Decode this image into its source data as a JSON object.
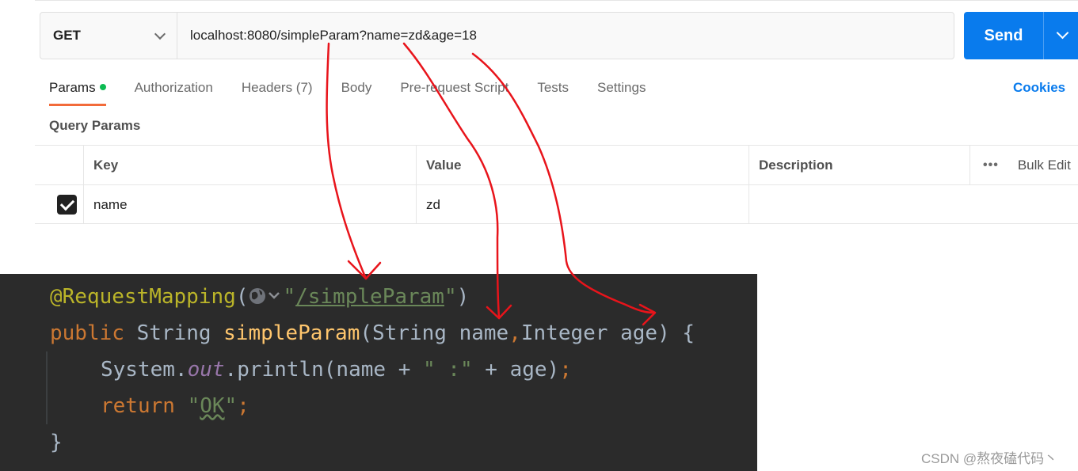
{
  "request": {
    "method": "GET",
    "url": "localhost:8080/simpleParam?name=zd&age=18",
    "send_label": "Send"
  },
  "tabs": [
    {
      "label": "Params",
      "active": true,
      "has_dot": true
    },
    {
      "label": "Authorization"
    },
    {
      "label": "Headers (7)"
    },
    {
      "label": "Body"
    },
    {
      "label": "Pre-request Script"
    },
    {
      "label": "Tests"
    },
    {
      "label": "Settings"
    }
  ],
  "cookies_label": "Cookies",
  "query_params": {
    "title": "Query Params",
    "headers": {
      "key": "Key",
      "value": "Value",
      "description": "Description",
      "more": "•••",
      "bulk_edit": "Bulk Edit"
    },
    "rows": [
      {
        "checked": true,
        "key": "name",
        "value": "zd",
        "description": ""
      }
    ]
  },
  "code": {
    "annotation": "@RequestMapping",
    "path": "/simpleParam",
    "kw_public": "public",
    "ret_type": "String",
    "method_name": "simpleParam",
    "param1_type": "String",
    "param1_name": "name",
    "param2_type": "Integer",
    "param2_name": "age",
    "sys": "System.",
    "out": "out",
    "println": ".println(name + ",
    "str_sep": "\" :\"",
    "println_tail": " + age)",
    "kw_return": "return",
    "ok": "OK",
    "close_brace": "}"
  },
  "watermark": "CSDN @熬夜磕代码丶",
  "colors": {
    "send": "#097bed",
    "active_tab_underline": "#f26b3a",
    "params_dot": "#0cbb52",
    "arrow": "#e8141b",
    "code_bg": "#2b2b2b"
  }
}
